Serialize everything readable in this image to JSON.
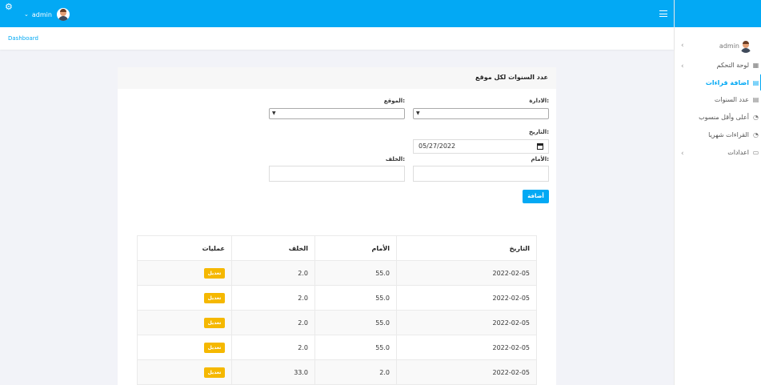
{
  "topbar": {
    "user_name": "admin"
  },
  "breadcrumb": {
    "label": "Dashboard"
  },
  "sidebar": {
    "user_name": "admin",
    "items": [
      {
        "label": "لوحة التحكم",
        "icon": "grid-icon",
        "has_children": true,
        "active": false
      },
      {
        "label": "اضافة قراءات",
        "icon": "calendar-icon",
        "has_children": false,
        "active": true
      },
      {
        "label": "عدد السنوات",
        "icon": "calendar-icon",
        "has_children": false,
        "active": false
      },
      {
        "label": "أعلى وأقل منسوب",
        "icon": "gauge-icon",
        "has_children": false,
        "active": false
      },
      {
        "label": "القراءات شهريا",
        "icon": "gauge-icon",
        "has_children": false,
        "active": false
      },
      {
        "label": "اعدادات",
        "icon": "monitor-icon",
        "has_children": true,
        "active": false
      }
    ]
  },
  "card": {
    "title": "عدد السنوات لكل موقع"
  },
  "form": {
    "admin_label": "الادارة:",
    "site_label": "الموقع:",
    "date_label": "التاريخ:",
    "date_value": "05/27/2022",
    "front_label": "الأمام:",
    "back_label": "الخلف:",
    "add_button": "أضافة"
  },
  "table": {
    "headers": [
      "التاريخ",
      "الأمام",
      "الخلف",
      "عمليات"
    ],
    "edit_label": "تعديل",
    "rows": [
      [
        "2022-02-05",
        "55.0",
        "2.0"
      ],
      [
        "2022-02-05",
        "55.0",
        "2.0"
      ],
      [
        "2022-02-05",
        "55.0",
        "2.0"
      ],
      [
        "2022-02-05",
        "55.0",
        "2.0"
      ],
      [
        "2022-02-05",
        "2.0",
        "33.0"
      ]
    ]
  },
  "colors": {
    "primary": "#03a9f4",
    "edit": "#f5b800"
  }
}
